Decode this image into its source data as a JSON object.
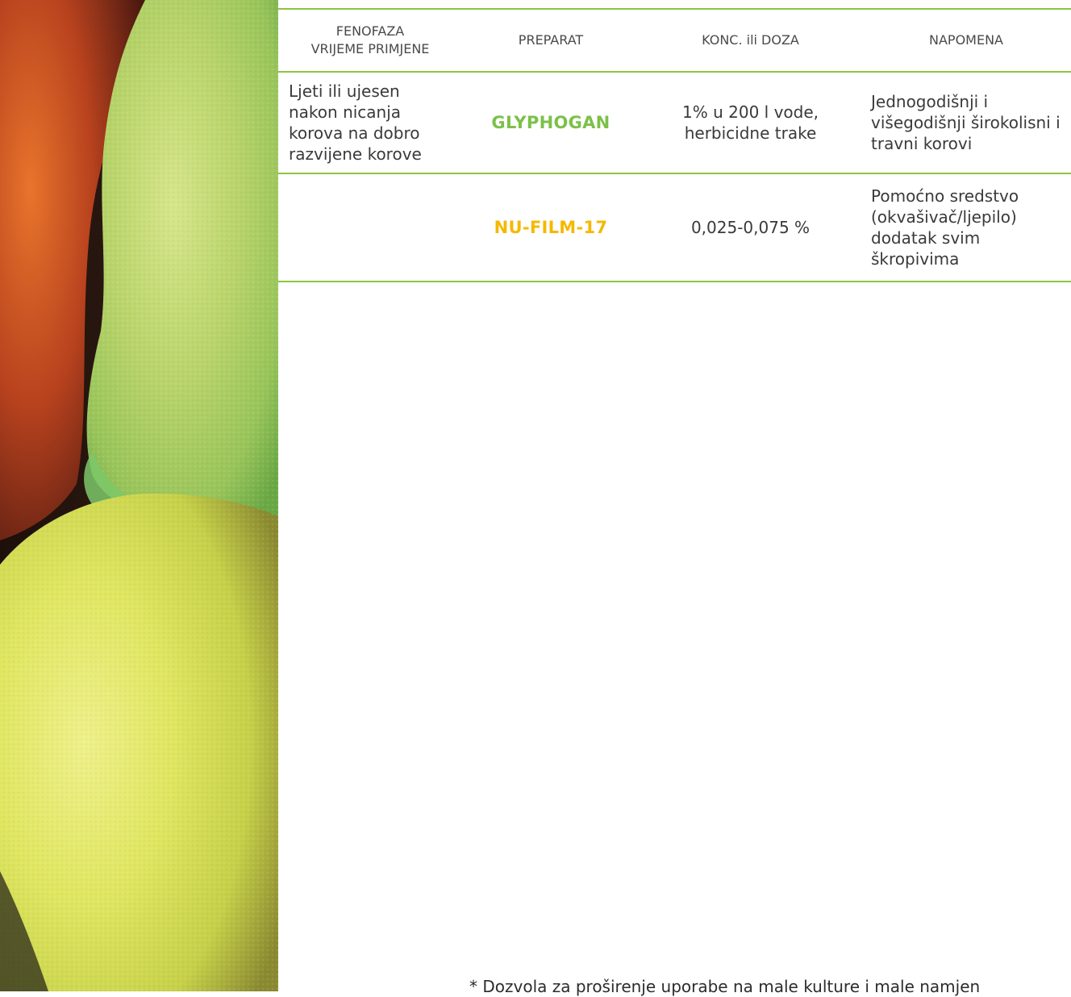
{
  "colors": {
    "accent_green": "#8cc63f",
    "glyphogan": "#7cc04a",
    "nu_film": "#f5b800"
  },
  "photo": {
    "description_icon": "citrus-fruit-photo"
  },
  "table": {
    "headers": {
      "stage_line1": "FENOFAZA",
      "stage_line2": "VRIJEME PRIMJENE",
      "product": "PREPARAT",
      "dose": "KONC. ili DOZA",
      "note": "NAPOMENA"
    },
    "rows": [
      {
        "stage": "Ljeti ili ujesen nakon nicanja korova na dobro razvijene korove",
        "product": "GLYPHOGAN",
        "product_color": "#7cc04a",
        "dose": "1% u 200 l vode, herbicidne trake",
        "note": "Jednogodišnji i višegodišnji širokolisni i travni korovi"
      },
      {
        "stage": "",
        "product": "NU-FILM-17",
        "product_color": "#f5b800",
        "dose": "0,025-0,075 %",
        "note": "Pomoćno sredstvo (okvašivač/ljepilo) dodatak svim škropivima"
      }
    ]
  },
  "footnote": "* Dozvola za proširenje uporabe na male kulture i male namjen"
}
